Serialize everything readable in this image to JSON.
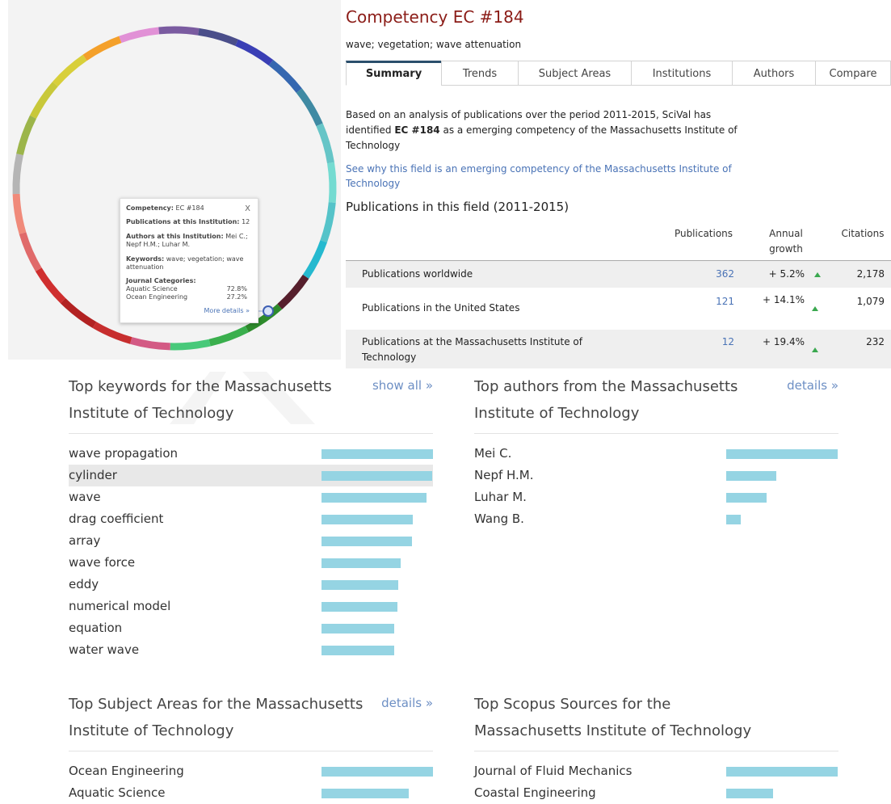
{
  "wheel": {
    "segment_colors": [
      "#e191d6",
      "#7a5ba0",
      "#4a4e8a",
      "#3a3fb5",
      "#3567b0",
      "#3f8aa3",
      "#66c5c7",
      "#74dbd1",
      "#55c3c9",
      "#25b9cf",
      "#561f2c",
      "#2e8b2c",
      "#3aaf4d",
      "#48c97a",
      "#d35a84",
      "#c72e2e",
      "#b22222",
      "#cf2f2f",
      "#e06a6a",
      "#f08a7a",
      "#b5b5b5",
      "#9cb54a",
      "#c8c83a",
      "#d8cf3a",
      "#f4a02a"
    ],
    "tooltip": {
      "competency_label": "Competency:",
      "competency_value": "EC #184",
      "close": "X",
      "pubs_label": "Publications at this Institution:",
      "pubs_value": "12",
      "authors_label": "Authors at this Institution:",
      "authors_value": "Mei C.; Nepf H.M.; Luhar M.",
      "keywords_label": "Keywords:",
      "keywords_value": "wave; vegetation; wave attenuation",
      "journal_label": "Journal Categories:",
      "categories": [
        {
          "name": "Aquatic Science",
          "value": "72.8%"
        },
        {
          "name": "Ocean Engineering",
          "value": "27.2%"
        }
      ],
      "more": "More details »"
    }
  },
  "header": {
    "title": "Competency EC #184",
    "subtitle": "wave; vegetation; wave attenuation"
  },
  "tabs": [
    "Summary",
    "Trends",
    "Subject Areas",
    "Institutions",
    "Authors",
    "Compare"
  ],
  "intro": {
    "part1": "Based on an analysis of publications over the period 2011-2015, SciVal has identified ",
    "bold": "EC #184",
    "part2": " as a emerging competency of the Massachusetts Institute of Technology"
  },
  "see_why": "See why this field is an emerging competency of the Massachusetts Institute of Technology",
  "publications": {
    "heading": "Publications in this field (2011-2015)",
    "col_publications": "Publications",
    "col_growth": "Annual growth",
    "col_citations": "Citations",
    "rows": [
      {
        "label": "Publications worldwide",
        "pubs": "362",
        "growth": "+ 5.2%",
        "citations": "2,178"
      },
      {
        "label": "Publications in the United States",
        "pubs": "121",
        "growth": "+ 14.1%",
        "citations": "1,079"
      },
      {
        "label": "Publications at the Massachusetts Institute of Technology",
        "pubs": "12",
        "growth": "+ 19.4%",
        "citations": "232"
      }
    ]
  },
  "keywords": {
    "heading": "Top keywords for the Massachusetts Institute of Technology",
    "link": "show all »",
    "items": [
      {
        "label": "wave propagation",
        "value": 1.0
      },
      {
        "label": "cylinder",
        "value": 0.99
      },
      {
        "label": "wave",
        "value": 0.94
      },
      {
        "label": "drag coefficient",
        "value": 0.82
      },
      {
        "label": "array",
        "value": 0.81
      },
      {
        "label": "wave force",
        "value": 0.71
      },
      {
        "label": "eddy",
        "value": 0.69
      },
      {
        "label": "numerical model",
        "value": 0.68
      },
      {
        "label": "equation",
        "value": 0.65
      },
      {
        "label": "water wave",
        "value": 0.65
      }
    ]
  },
  "authors": {
    "heading": "Top authors from the Massachusetts Institute of Technology",
    "link": "details »",
    "items": [
      {
        "label": "Mei C.",
        "value": 1.0
      },
      {
        "label": "Nepf H.M.",
        "value": 0.45
      },
      {
        "label": "Luhar M.",
        "value": 0.36
      },
      {
        "label": "Wang B.",
        "value": 0.13
      }
    ]
  },
  "subjects": {
    "heading": "Top Subject Areas for the Massachusetts Institute of Technology",
    "link": "details »",
    "items": [
      {
        "label": "Ocean Engineering",
        "value": 1.0
      },
      {
        "label": "Aquatic Science",
        "value": 0.78
      }
    ]
  },
  "sources": {
    "heading": "Top Scopus Sources for the Massachusetts Institute of Technology",
    "items": [
      {
        "label": "Journal of Fluid Mechanics",
        "value": 1.0
      },
      {
        "label": "Coastal Engineering",
        "value": 0.42
      }
    ]
  }
}
